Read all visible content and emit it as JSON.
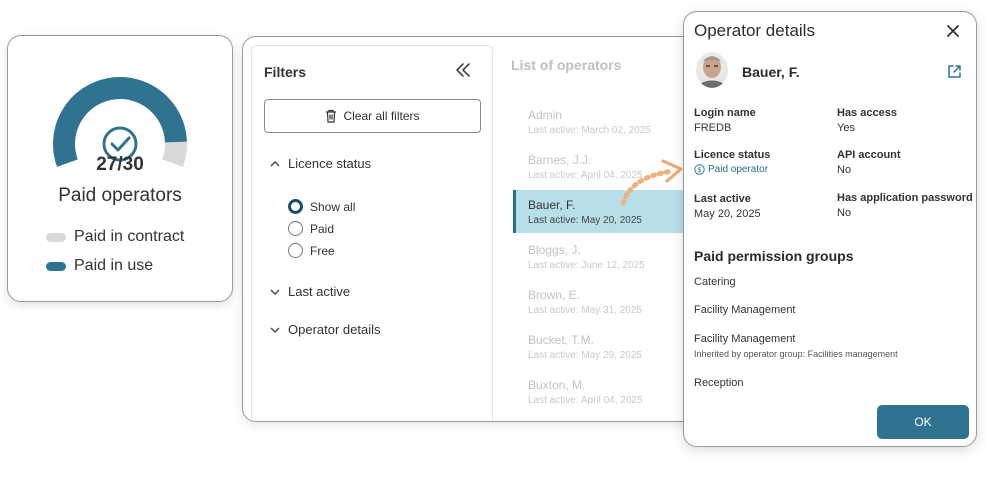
{
  "gauge": {
    "count": "27/30",
    "value": 27,
    "total": 30,
    "caption": "Paid operators",
    "legend": [
      {
        "label": "Paid in contract",
        "color": "#d9d9d9"
      },
      {
        "label": "Paid in use",
        "color": "#2f7391"
      }
    ],
    "icon": "check-circle-icon"
  },
  "filters": {
    "title": "Filters",
    "collapse_icon": "double-chevron-left-icon",
    "clear_label": "Clear all filters",
    "clear_icon": "trash-icon",
    "licence_status": {
      "label": "Licence status",
      "options": [
        "Show all",
        "Paid",
        "Free"
      ],
      "selected": "Show all"
    },
    "last_active": {
      "label": "Last active"
    },
    "operator_details": {
      "label": "Operator details"
    }
  },
  "operator_list": {
    "title": "List of operators",
    "items": [
      {
        "name": "Admin",
        "last_active": "Last active: March 02, 2025"
      },
      {
        "name": "Barnes, J.J.",
        "last_active": "Last active: April 04, 2025"
      },
      {
        "name": "Bauer, F.",
        "last_active": "Last active: May 20, 2025",
        "selected": true
      },
      {
        "name": "Bloggs, J.",
        "last_active": "Last active: June 12, 2025"
      },
      {
        "name": "Brown, E.",
        "last_active": "Last active: May 31, 2025"
      },
      {
        "name": "Bucket, T.M.",
        "last_active": "Last active: May 29, 2025"
      },
      {
        "name": "Buxton, M.",
        "last_active": "Last active: April 04, 2025"
      }
    ]
  },
  "details": {
    "title": "Operator details",
    "name": "Bauer, F.",
    "fields": {
      "login_name": {
        "label": "Login name",
        "value": "FREDB"
      },
      "has_access": {
        "label": "Has access",
        "value": "Yes"
      },
      "licence_status": {
        "label": "Licence status",
        "value": "Paid operator"
      },
      "api_account": {
        "label": "API account",
        "value": "No"
      },
      "last_active": {
        "label": "Last active",
        "value": "May 20, 2025"
      },
      "app_password": {
        "label": "Has application password",
        "value": "No"
      }
    },
    "groups_title": "Paid permission groups",
    "groups": [
      {
        "name": "Catering"
      },
      {
        "name": "Facility Management"
      },
      {
        "name": "Facility Management",
        "note": "Inherited by operator group: Facilities management"
      },
      {
        "name": "Reception"
      }
    ],
    "ok_label": "OK",
    "accent": "#2f7391"
  }
}
